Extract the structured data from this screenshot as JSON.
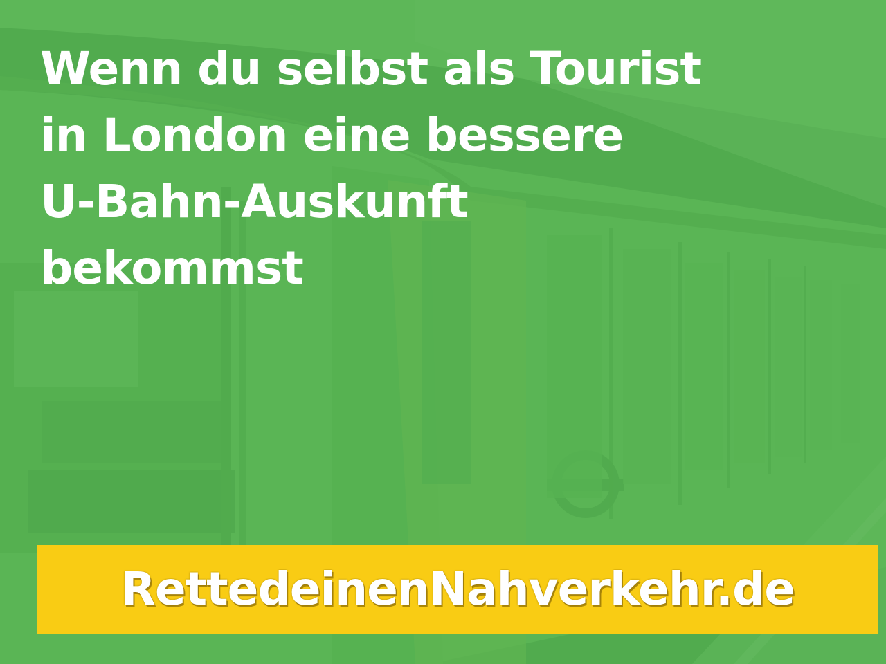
{
  "headline": {
    "lines": [
      "Wenn du selbst als Tourist",
      "in London eine bessere",
      "U-Bahn-Auskunft",
      "bekommst"
    ]
  },
  "banner": {
    "text": "RettedeinenNahverkehr.de",
    "background_color": "#f9cc14",
    "text_color": "#ffffff"
  },
  "overlay": {
    "color": "#56b250"
  },
  "background": {
    "subject": "london-underground-train-at-platform"
  }
}
